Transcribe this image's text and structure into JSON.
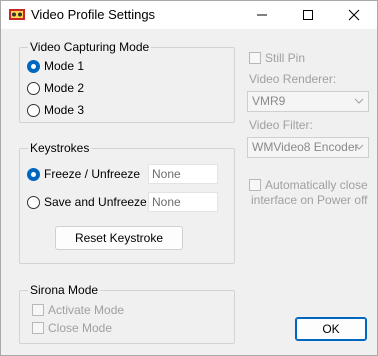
{
  "window": {
    "title": "Video Profile Settings"
  },
  "titlebar": {
    "minimize_glyph": "—",
    "maximize_glyph": "☐",
    "close_glyph": "✕"
  },
  "capture_mode": {
    "legend": "Video Capturing Mode",
    "options": [
      "Mode 1",
      "Mode 2",
      "Mode 3"
    ],
    "selected": "Mode 1"
  },
  "keystrokes": {
    "legend": "Keystrokes",
    "freeze_label": "Freeze / Unfreeze",
    "freeze_value": "None",
    "save_label": "Save and Unfreeze",
    "save_value": "None",
    "selected": "Freeze / Unfreeze",
    "reset_label": "Reset Keystroke"
  },
  "sirona": {
    "legend": "Sirona Mode",
    "activate_label": "Activate Mode",
    "close_label": "Close Mode"
  },
  "right_panel": {
    "still_pin_label": "Still Pin",
    "renderer_label": "Video Renderer:",
    "renderer_value": "VMR9",
    "filter_label": "Video Filter:",
    "filter_value": "WMVideo8 Encoder",
    "auto_close_line1": "Automatically close",
    "auto_close_line2": "interface on Power off"
  },
  "ok_label": "OK",
  "colors": {
    "accent": "#0067c0",
    "disabled_text": "#a0a0a0"
  }
}
